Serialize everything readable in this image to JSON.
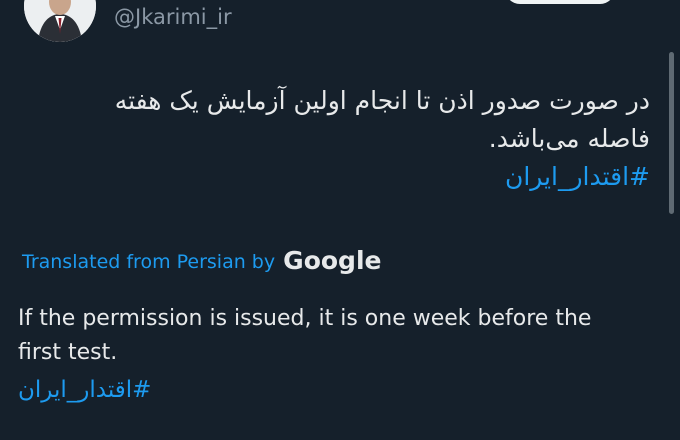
{
  "header": {
    "handle": "@Jkarimi_ir"
  },
  "tweet": {
    "persian_lines": [
      "در صورت صدور اذن تا انجام اولین آزمایش یک هفته",
      "فاصله می‌باشد."
    ],
    "hashtag_fa": "#اقتدار_ایران"
  },
  "translation": {
    "label": "Translated from Persian by",
    "brand": "Google",
    "lines": [
      "If the permission is issued, it is one week before the",
      "first test."
    ],
    "hashtag": "#اقتدار_ایران"
  },
  "colors": {
    "background": "#15202b",
    "text": "#e7e9ea",
    "link": "#1d9bf0",
    "muted": "#8b98a5"
  }
}
